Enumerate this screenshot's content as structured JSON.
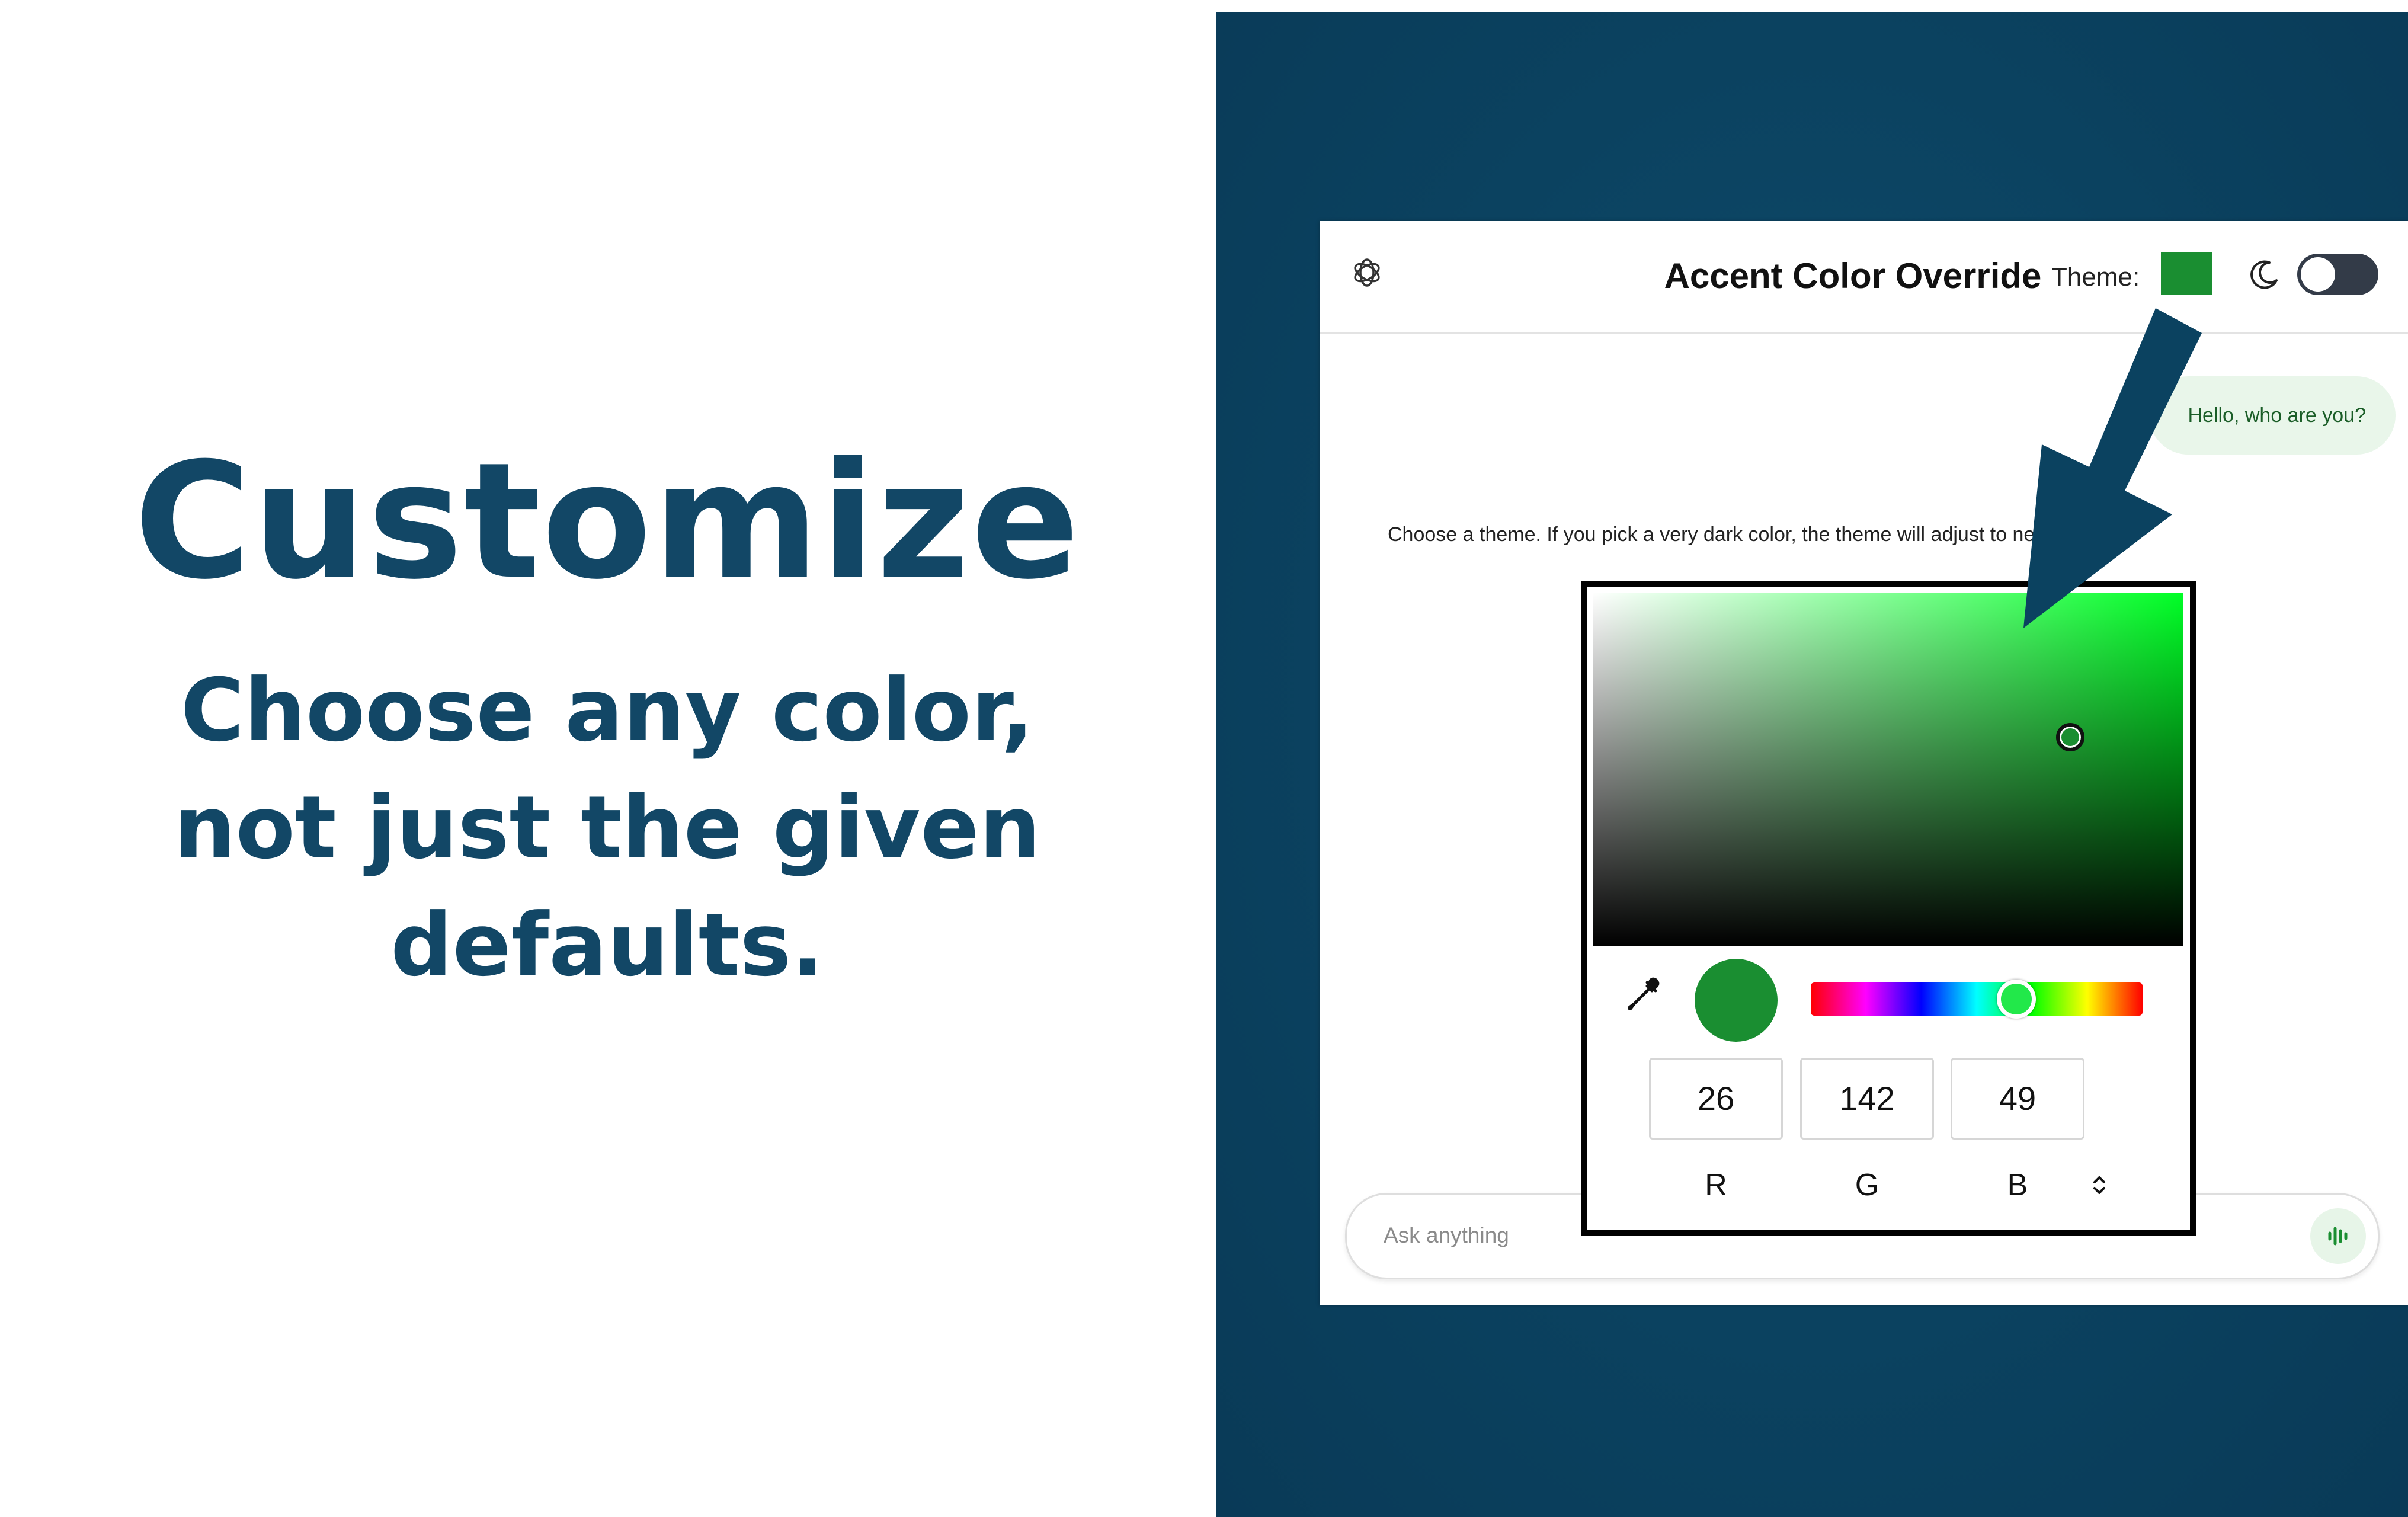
{
  "slide": {
    "headline": "Customize",
    "subheadline": "Choose any color, not just the given defaults."
  },
  "app": {
    "title": "Accent Color Override",
    "theme_label": "Theme:",
    "theme_color": "#1a8e31",
    "dark_mode_enabled": false
  },
  "chat": {
    "user_message": "Hello, who are you?",
    "assistant_message": "Choose a theme. If you pick a very dark color, the theme will adjust to neutral grays."
  },
  "composer": {
    "placeholder": "Ask anything"
  },
  "color_picker": {
    "selected_color": "#1a8e31",
    "r": "26",
    "g": "142",
    "b": "49",
    "r_label": "R",
    "g_label": "G",
    "b_label": "B",
    "mode": "RGB"
  },
  "colors": {
    "headline": "#124766",
    "panel_background": "#0b4260",
    "arrow": "#0b4260",
    "accent": "#1a8e31"
  },
  "icons": [
    "openai-logo-icon",
    "moon-icon",
    "eyedropper-icon",
    "voice-icon",
    "chevron-updown-icon",
    "arrow-pointer-icon"
  ]
}
